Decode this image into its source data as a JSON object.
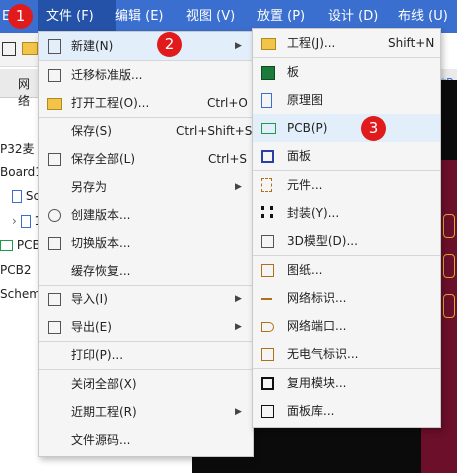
{
  "menubar": {
    "items": [
      {
        "label": "文件 (F)"
      },
      {
        "label": "编辑 (E)"
      },
      {
        "label": "视图 (V)"
      },
      {
        "label": "放置 (P)"
      },
      {
        "label": "设计 (D)"
      },
      {
        "label": "布线 (U)"
      }
    ],
    "truncated_left": "E"
  },
  "markers": [
    "1",
    "2",
    "3"
  ],
  "background": {
    "tab_left": "网络",
    "tab_right": "*P",
    "tree": [
      "P32麦",
      "Board1",
      "Sche",
      "1",
      "PCB",
      "PCB2",
      "Schem"
    ]
  },
  "file_menu": {
    "items": [
      {
        "label": "新建(N)",
        "shortcut": "",
        "has_submenu": true
      },
      {
        "label": "迁移标准版...",
        "shortcut": "",
        "has_submenu": false
      },
      {
        "label": "打开工程(O)...",
        "shortcut": "Ctrl+O",
        "has_submenu": false
      },
      {
        "label": "保存(S)",
        "shortcut": "Ctrl+Shift+S",
        "has_submenu": false
      },
      {
        "label": "保存全部(L)",
        "shortcut": "Ctrl+S",
        "has_submenu": false
      },
      {
        "label": "另存为",
        "shortcut": "",
        "has_submenu": true
      },
      {
        "label": "创建版本...",
        "shortcut": "",
        "has_submenu": false
      },
      {
        "label": "切换版本...",
        "shortcut": "",
        "has_submenu": false
      },
      {
        "label": "缓存恢复...",
        "shortcut": "",
        "has_submenu": false
      },
      {
        "label": "导入(I)",
        "shortcut": "",
        "has_submenu": true
      },
      {
        "label": "导出(E)",
        "shortcut": "",
        "has_submenu": true
      },
      {
        "label": "打印(P)...",
        "shortcut": "",
        "has_submenu": false
      },
      {
        "label": "关闭全部(X)",
        "shortcut": "",
        "has_submenu": false
      },
      {
        "label": "近期工程(R)",
        "shortcut": "",
        "has_submenu": true
      },
      {
        "label": "文件源码...",
        "shortcut": "",
        "has_submenu": false
      }
    ]
  },
  "new_submenu": {
    "items": [
      {
        "label": "工程(J)...",
        "shortcut": "Shift+N",
        "icon": "folder-icon"
      },
      {
        "label": "板",
        "shortcut": "",
        "icon": "board-icon"
      },
      {
        "label": "原理图",
        "shortcut": "",
        "icon": "schematic-icon"
      },
      {
        "label": "PCB(P)",
        "shortcut": "",
        "icon": "pcb-icon"
      },
      {
        "label": "面板",
        "shortcut": "",
        "icon": "panel-icon"
      },
      {
        "label": "元件...",
        "shortcut": "",
        "icon": "component-icon"
      },
      {
        "label": "封装(Y)...",
        "shortcut": "",
        "icon": "footprint-icon"
      },
      {
        "label": "3D模型(D)...",
        "shortcut": "",
        "icon": "cube-3d-icon"
      },
      {
        "label": "图纸...",
        "shortcut": "",
        "icon": "sheet-icon"
      },
      {
        "label": "网络标识...",
        "shortcut": "",
        "icon": "net-label-icon"
      },
      {
        "label": "网络端口...",
        "shortcut": "",
        "icon": "net-port-icon"
      },
      {
        "label": "无电气标识...",
        "shortcut": "",
        "icon": "non-electrical-icon"
      },
      {
        "label": "复用模块...",
        "shortcut": "",
        "icon": "reuse-module-icon"
      },
      {
        "label": "面板库...",
        "shortcut": "",
        "icon": "panel-library-icon"
      }
    ]
  },
  "colors": {
    "menubar": "#3b6fcf",
    "menubar_active": "#2452a8",
    "highlight": "#e3eefb",
    "marker": "#e11b1b",
    "canvas": "#0b0b0b",
    "canvas_board": "#6b0f2a"
  }
}
